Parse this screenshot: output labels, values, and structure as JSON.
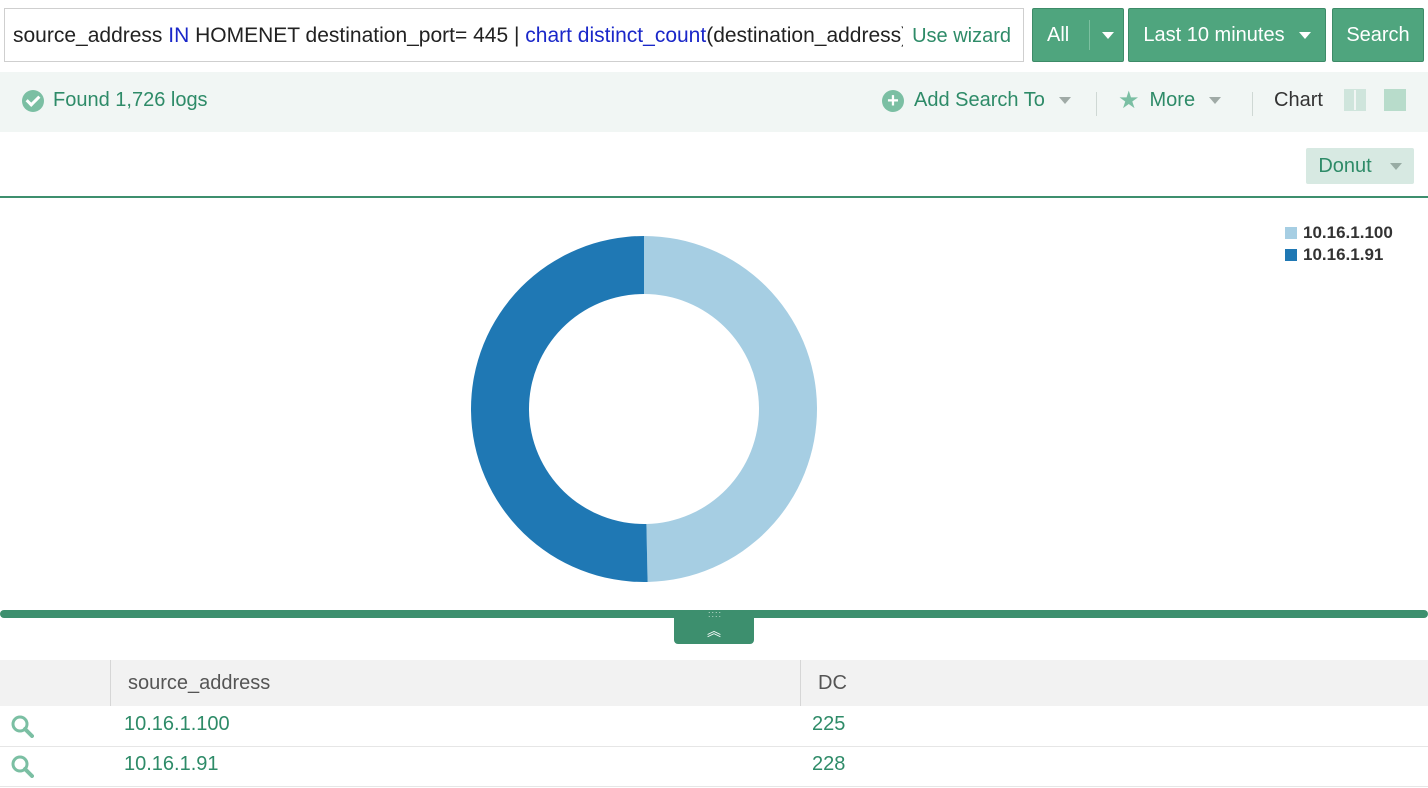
{
  "query": {
    "parts": [
      {
        "text": "source_address ",
        "kw": false
      },
      {
        "text": "IN",
        "kw": true
      },
      {
        "text": " HOMENET  destination_port= 445 | ",
        "kw": false
      },
      {
        "text": "chart distinct_count",
        "kw": true
      },
      {
        "text": "(destination_address) as DC by source_address",
        "kw": false
      }
    ],
    "use_wizard": "Use wizard"
  },
  "controls": {
    "all_label": "All",
    "time_label": "Last 10 minutes",
    "search_label": "Search"
  },
  "status": {
    "found_text": "Found 1,726 logs",
    "add_search_to": "Add Search To",
    "more": "More",
    "chart": "Chart"
  },
  "chart_controls": {
    "type_label": "Donut"
  },
  "colors": {
    "accent": "#2e8b68",
    "button": "#4fa57e",
    "slice1": "#a6cee3",
    "slice2": "#1f78b4"
  },
  "chart_data": {
    "type": "pie",
    "donut": true,
    "categories": [
      "10.16.1.100",
      "10.16.1.91"
    ],
    "values": [
      225,
      228
    ],
    "colors": [
      "#a6cee3",
      "#1f78b4"
    ],
    "legend": "top-right"
  },
  "table": {
    "columns": [
      "source_address",
      "DC"
    ],
    "rows": [
      {
        "source_address": "10.16.1.100",
        "DC": "225"
      },
      {
        "source_address": "10.16.1.91",
        "DC": "228"
      }
    ]
  }
}
